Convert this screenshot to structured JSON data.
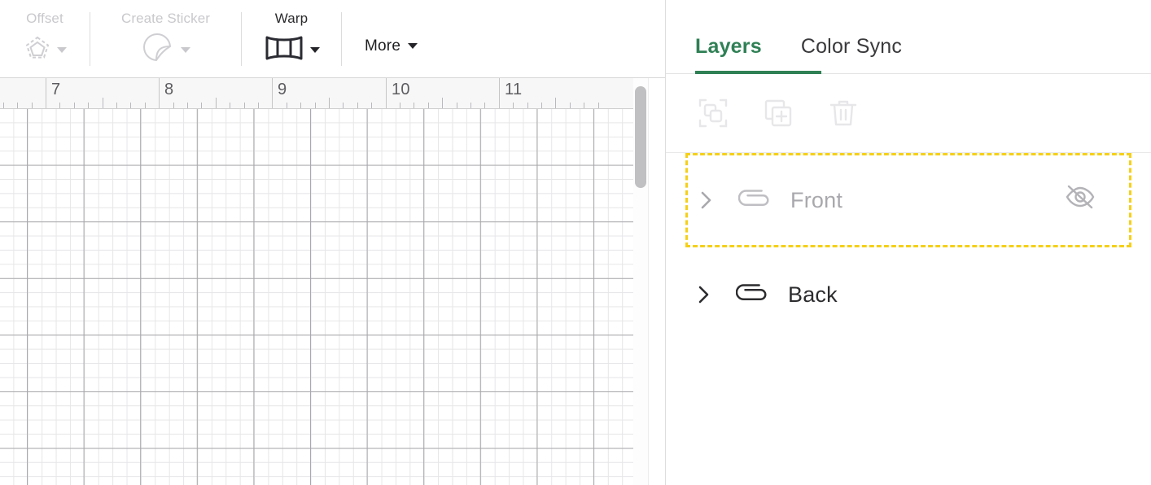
{
  "toolbar": {
    "tools": [
      {
        "label": "Offset",
        "icon": "offset-pentagon-icon",
        "enabled": false,
        "has_caret": true
      },
      {
        "label": "Create Sticker",
        "icon": "sticker-peel-icon",
        "enabled": false,
        "has_caret": true
      },
      {
        "label": "Warp",
        "icon": "warp-pincushion-icon",
        "enabled": true,
        "has_caret": true
      }
    ],
    "more_label": "More",
    "more_icon": "chevron-down-icon"
  },
  "ruler": {
    "unit_labels": [
      "7",
      "8",
      "9",
      "10",
      "11"
    ],
    "subdivisions_per_inch": 8
  },
  "canvas": {
    "scrollbar_icon": "vertical-scrollbar-thumb"
  },
  "panel": {
    "tabs": [
      {
        "label": "Layers",
        "active": true
      },
      {
        "label": "Color Sync",
        "active": false
      }
    ],
    "actions": [
      {
        "icon": "select-group-icon",
        "enabled": false
      },
      {
        "icon": "duplicate-layer-icon",
        "enabled": false
      },
      {
        "icon": "trash-icon",
        "enabled": false
      }
    ],
    "layers": [
      {
        "name": "Front",
        "icon": "paperclip-icon",
        "expand_icon": "chevron-right-icon",
        "visibility_icon": "eye-off-icon",
        "visible": false,
        "selected": true
      },
      {
        "name": "Back",
        "icon": "paperclip-icon",
        "expand_icon": "chevron-right-icon",
        "visibility_icon": "",
        "visible": true,
        "selected": false
      }
    ]
  },
  "colors": {
    "accent_green": "#2f8055",
    "selection_yellow": "#f5d019",
    "disabled_gray": "#c9c9cd",
    "text_dark": "#2c2c2f"
  }
}
